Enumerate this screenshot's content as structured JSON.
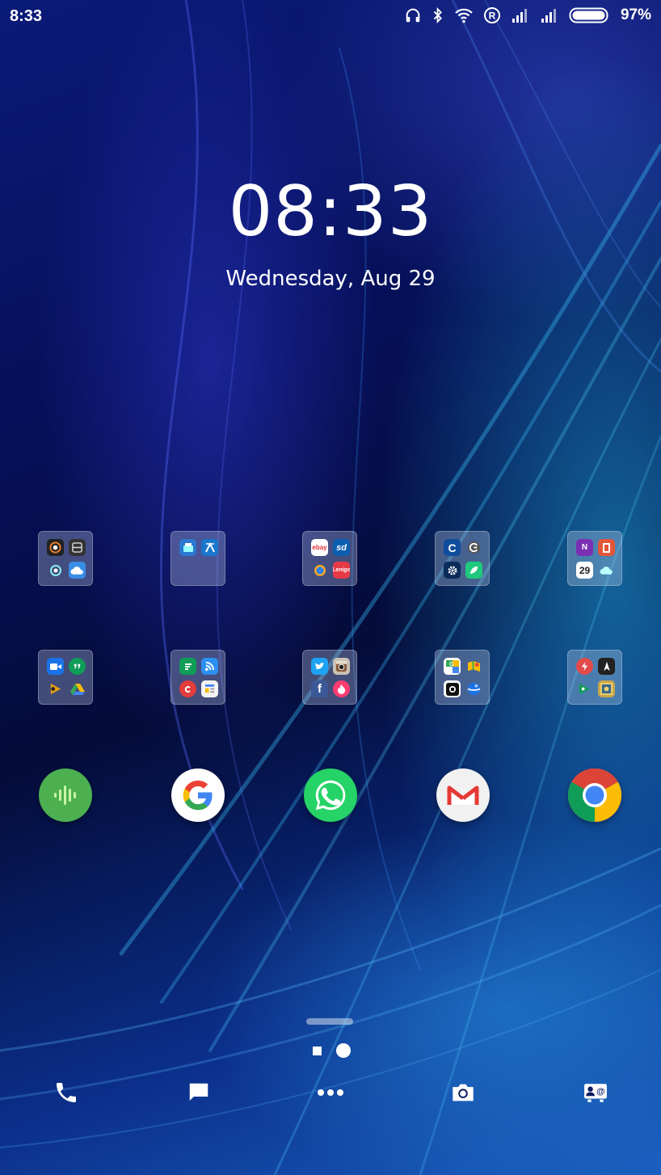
{
  "status_bar": {
    "time": "8:33",
    "battery_percent": "97%",
    "icons": [
      "headphones-icon",
      "bluetooth-icon",
      "wifi-icon",
      "registered-icon",
      "signal-icon",
      "signal-icon",
      "battery-icon"
    ]
  },
  "lock_clock": {
    "time": "08:33",
    "date": "Wednesday, Aug 29"
  },
  "folders": [
    {
      "name": "folder-1",
      "apps": [
        "camera-app-icon",
        "notes-app-icon",
        "location-app-icon",
        "weather-app-icon"
      ]
    },
    {
      "name": "folder-2",
      "apps": [
        "file-manager-app-icon",
        "transfer-app-icon"
      ]
    },
    {
      "name": "folder-3",
      "apps": [
        "ebay-app-icon",
        "sd-app-icon",
        "browser-app-icon",
        "lenigo-app-icon"
      ],
      "labels": {
        "ebay": "ebay",
        "sd": "sd",
        "lenigo": "Lenigo"
      }
    },
    {
      "name": "folder-4",
      "apps": [
        "c-app-icon",
        "g-app-icon",
        "settings-app-icon",
        "leaf-app-icon"
      ]
    },
    {
      "name": "folder-5",
      "apps": [
        "onenote-app-icon",
        "office-app-icon",
        "calendar-app-icon",
        "cloud-app-icon"
      ],
      "labels": {
        "calendar_day": "29"
      }
    },
    {
      "name": "folder-6",
      "apps": [
        "duo-app-icon",
        "hangouts-app-icon",
        "plex-app-icon",
        "drive-app-icon"
      ]
    },
    {
      "name": "folder-7",
      "apps": [
        "sheets-app-icon",
        "feedly-app-icon",
        "pocket-app-icon",
        "newspaper-app-icon"
      ]
    },
    {
      "name": "folder-8",
      "apps": [
        "twitter-app-icon",
        "instagram-app-icon",
        "facebook-app-icon",
        "tinder-app-icon"
      ]
    },
    {
      "name": "folder-9",
      "apps": [
        "maps-app-icon",
        "gallery-app-icon",
        "uber-app-icon",
        "earth-app-icon"
      ]
    },
    {
      "name": "folder-10",
      "apps": [
        "flash-app-icon",
        "compass-app-icon",
        "play-games-app-icon",
        "photo-app-icon"
      ]
    }
  ],
  "dock_apps": [
    "sound-app-icon",
    "google-app-icon",
    "whatsapp-app-icon",
    "gmail-app-icon",
    "chrome-app-icon"
  ],
  "bottom_dock": [
    "phone-icon",
    "messages-icon",
    "app-drawer-icon",
    "camera-icon",
    "contacts-icon"
  ],
  "pager": {
    "pages": 2,
    "current": 2
  },
  "colors": {
    "accent_blue": "#1e9be0",
    "wallpaper_dark": "#06105a"
  }
}
